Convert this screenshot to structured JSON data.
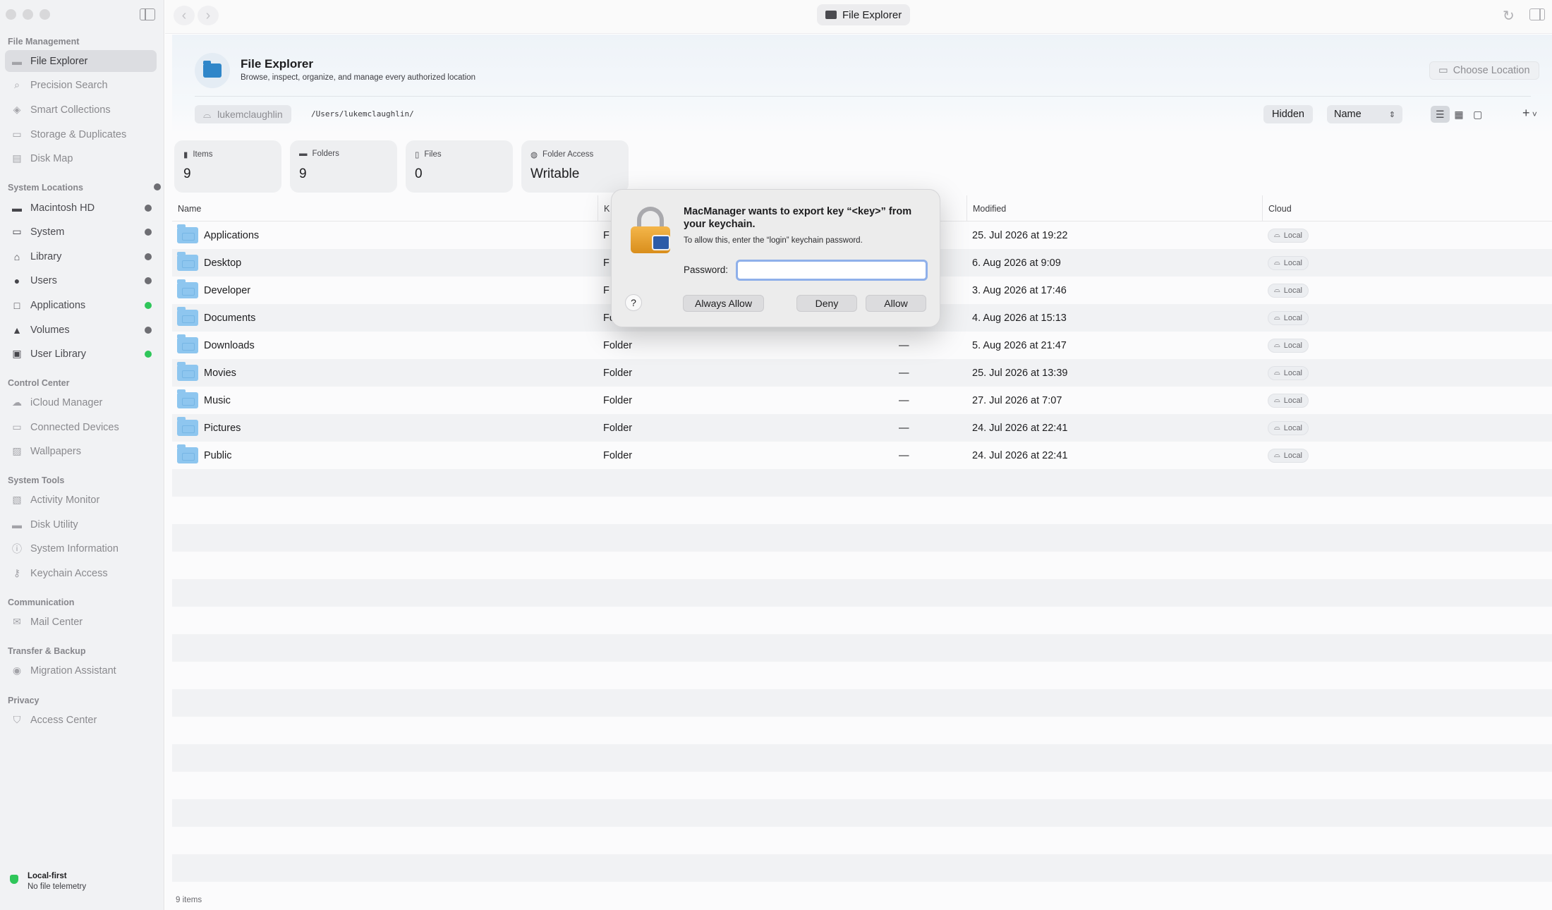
{
  "window": {
    "title": "File Explorer"
  },
  "sidebar": {
    "sections": [
      {
        "title": "File Management"
      },
      {
        "title": "System Locations"
      },
      {
        "title": "Control Center"
      },
      {
        "title": "System Tools"
      },
      {
        "title": "Communication"
      },
      {
        "title": "Transfer & Backup"
      },
      {
        "title": "Privacy"
      }
    ],
    "items": [
      {
        "label": "File Explorer",
        "icon": "folder-icon",
        "selected": true
      },
      {
        "label": "Precision Search",
        "icon": "magnifier-icon"
      },
      {
        "label": "Smart Collections",
        "icon": "layers-icon"
      },
      {
        "label": "Storage & Duplicates",
        "icon": "drive-icon"
      },
      {
        "label": "Disk Map",
        "icon": "map-icon"
      },
      {
        "label": "Macintosh HD",
        "icon": "drive-icon"
      },
      {
        "label": "System",
        "icon": "monitor-icon"
      },
      {
        "label": "Library",
        "icon": "building-icon"
      },
      {
        "label": "Users",
        "icon": "people-icon"
      },
      {
        "label": "Applications",
        "icon": "app-square-icon"
      },
      {
        "label": "Volumes",
        "icon": "lamp-icon"
      },
      {
        "label": "User Library",
        "icon": "id-card-icon"
      },
      {
        "label": "iCloud Manager",
        "icon": "cloud-icon"
      },
      {
        "label": "Connected Devices",
        "icon": "devices-icon"
      },
      {
        "label": "Wallpapers",
        "icon": "image-icon"
      },
      {
        "label": "Activity Monitor",
        "icon": "chart-icon"
      },
      {
        "label": "Disk Utility",
        "icon": "disk-icon"
      },
      {
        "label": "System Information",
        "icon": "info-icon"
      },
      {
        "label": "Keychain Access",
        "icon": "key-icon"
      },
      {
        "label": "Mail Center",
        "icon": "mail-icon"
      },
      {
        "label": "Migration Assistant",
        "icon": "migration-icon"
      },
      {
        "label": "Access Center",
        "icon": "shield-icon"
      }
    ],
    "footer": {
      "title": "Local-first",
      "subtitle": "No file telemetry"
    }
  },
  "header": {
    "title": "File Explorer",
    "subtitle": "Browse, inspect, organize, and manage every authorized location",
    "choose_location": "Choose Location",
    "breadcrumb_user": "lukemclaughlin",
    "path": "/Users/lukemclaughlin/",
    "hidden_label": "Hidden",
    "sort_value": "Name",
    "add_label": "+"
  },
  "stats": [
    {
      "label": "Items",
      "value": "9"
    },
    {
      "label": "Folders",
      "value": "9"
    },
    {
      "label": "Files",
      "value": "0"
    },
    {
      "label": "Folder Access",
      "value": "Writable"
    }
  ],
  "table": {
    "columns": {
      "name": "Name",
      "kind": "K",
      "modified": "Modified",
      "cloud": "Cloud"
    },
    "rows": [
      {
        "name": "Applications",
        "kind": "F",
        "size": "",
        "modified": "25. Jul 2026 at 19:22",
        "cloud": "Local"
      },
      {
        "name": "Desktop",
        "kind": "F",
        "size": "",
        "modified": "6. Aug 2026 at 9:09",
        "cloud": "Local"
      },
      {
        "name": "Developer",
        "kind": "F",
        "size": "",
        "modified": "3. Aug 2026 at 17:46",
        "cloud": "Local"
      },
      {
        "name": "Documents",
        "kind": "Fol",
        "size": "",
        "modified": "4. Aug 2026 at 15:13",
        "cloud": "Local"
      },
      {
        "name": "Downloads",
        "kind": "Folder",
        "size": "—",
        "modified": "5. Aug 2026 at 21:47",
        "cloud": "Local"
      },
      {
        "name": "Movies",
        "kind": "Folder",
        "size": "—",
        "modified": "25. Jul 2026 at 13:39",
        "cloud": "Local"
      },
      {
        "name": "Music",
        "kind": "Folder",
        "size": "—",
        "modified": "27. Jul 2026 at 7:07",
        "cloud": "Local"
      },
      {
        "name": "Pictures",
        "kind": "Folder",
        "size": "—",
        "modified": "24. Jul 2026 at 22:41",
        "cloud": "Local"
      },
      {
        "name": "Public",
        "kind": "Folder",
        "size": "—",
        "modified": "24. Jul 2026 at 22:41",
        "cloud": "Local"
      }
    ],
    "count_label": "9 items"
  },
  "dialog": {
    "title": "MacManager wants to export key “<key>” from your keychain.",
    "text": "To allow this, enter the “login” keychain password.",
    "password_label": "Password:",
    "password_value": "",
    "help": "?",
    "always_allow": "Always Allow",
    "deny": "Deny",
    "allow": "Allow"
  }
}
